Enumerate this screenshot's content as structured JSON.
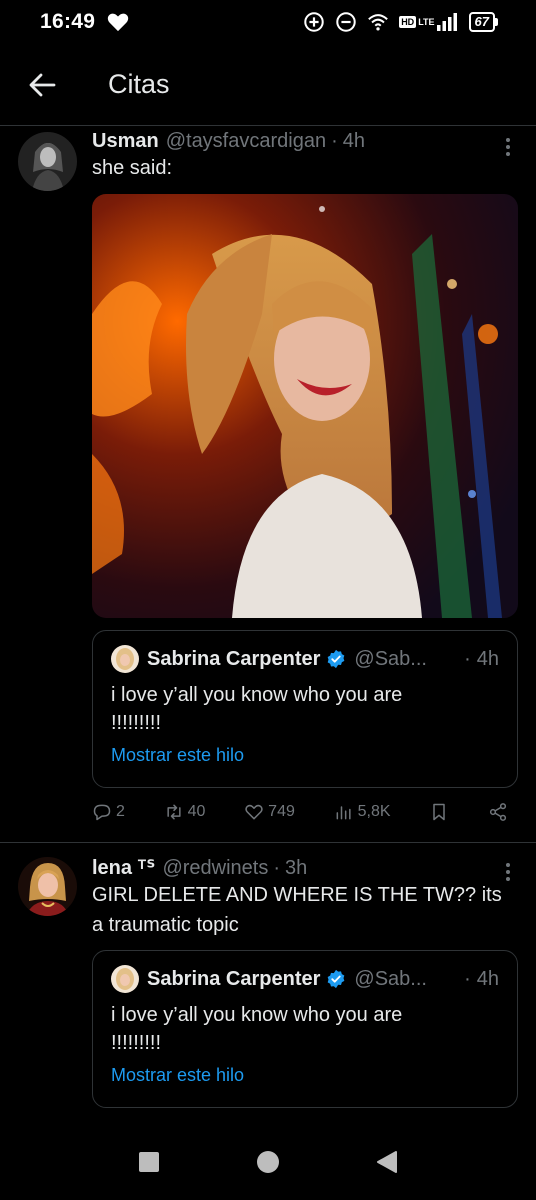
{
  "statusbar": {
    "time": "16:49",
    "battery": "67",
    "hd": "HD",
    "lte": "LTE"
  },
  "header": {
    "title": "Citas"
  },
  "tweets": [
    {
      "name": "Usman",
      "handle": "@taysfavcardigan",
      "dot": "·",
      "time": "4h",
      "text": "she said:",
      "quote": {
        "name": "Sabrina Carpenter",
        "handle": "@Sab...",
        "dot": "·",
        "time": "4h",
        "text": "i love y’all you know who you are !!!!!!!!!",
        "link": "Mostrar este hilo"
      },
      "stats": {
        "replies": "2",
        "reposts": "40",
        "likes": "749",
        "views": "5,8K"
      }
    },
    {
      "name": "lena ᵀᔆ",
      "handle": "@redwinets",
      "dot": "·",
      "time": "3h",
      "text": "GIRL DELETE AND WHERE IS THE TW?? its a traumatic topic",
      "quote": {
        "name": "Sabrina Carpenter",
        "handle": "@Sab...",
        "dot": "·",
        "time": "4h",
        "text": "i love y’all you know who you are !!!!!!!!!",
        "link": "Mostrar este hilo"
      }
    }
  ],
  "colors": {
    "background": "#000000",
    "accent": "#1d9bf0",
    "muted": "#71767b",
    "text": "#e7e9ea",
    "border": "#2f3336"
  },
  "icons": [
    "back-arrow-icon",
    "more-vertical-icon",
    "verified-badge-icon",
    "reply-icon",
    "repost-icon",
    "like-icon",
    "views-icon",
    "bookmark-icon",
    "share-icon"
  ]
}
